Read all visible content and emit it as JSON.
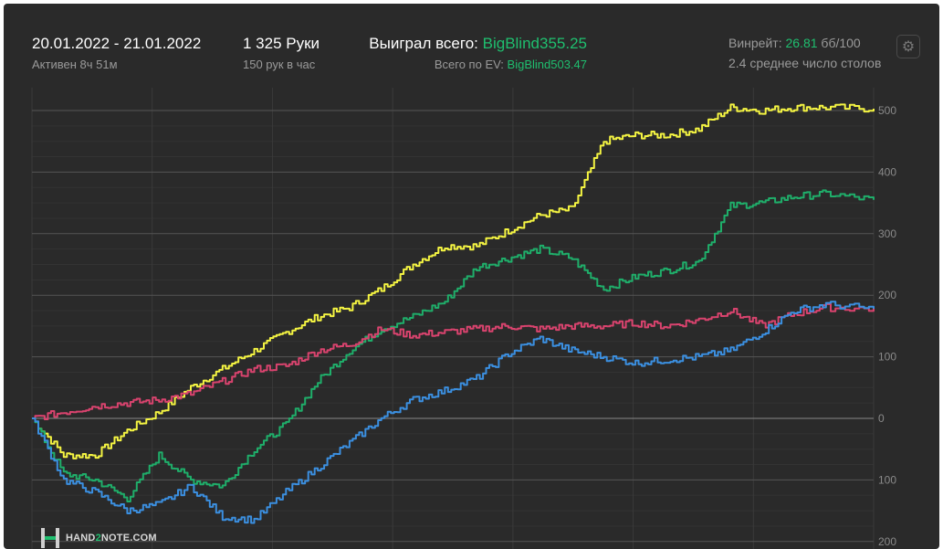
{
  "header": {
    "date_range": "20.01.2022 - 21.01.2022",
    "active_time": "Активен 8ч 51м",
    "hands": "1 325 Руки",
    "hands_per_hour": "150 рук в час",
    "won_label": "Выиграл всего: ",
    "won_value": "BigBlind355.25",
    "ev_label": "Всего по EV: ",
    "ev_value": "BigBlind503.47",
    "winrate_label": "Винрейт: ",
    "winrate_value": "26.81",
    "winrate_unit": " бб/100",
    "avg_tables": "2.4 среднее число столов"
  },
  "settings": {
    "icon": "gear-icon"
  },
  "logo": {
    "text_a": "HAND",
    "text_b": "2",
    "text_c": "NOTE.COM"
  },
  "colors": {
    "background": "#2a2a2a",
    "yellow": "#f4f442",
    "green": "#1fae6a",
    "pink": "#d9436e",
    "blue": "#3b8fe0",
    "accent": "#1fbf6f"
  },
  "chart_data": {
    "type": "line",
    "x": [
      0,
      50,
      100,
      150,
      200,
      250,
      300,
      350,
      400,
      450,
      500,
      550,
      600,
      650,
      700,
      750,
      800,
      850,
      900,
      950,
      1000,
      1050,
      1100,
      1150,
      1200,
      1250,
      1325
    ],
    "ylim": [
      -200,
      520
    ],
    "yticks": [
      500,
      400,
      300,
      200,
      100,
      0,
      -100,
      -200
    ],
    "ytick_labels": [
      "500",
      "400",
      "300",
      "200",
      "100",
      "0",
      "100",
      "200"
    ],
    "grid": true,
    "series": [
      {
        "color": "#f4f442",
        "values": [
          0,
          -60,
          -60,
          -20,
          10,
          50,
          80,
          110,
          140,
          165,
          180,
          210,
          250,
          280,
          280,
          305,
          330,
          340,
          450,
          460,
          460,
          470,
          505,
          500,
          505,
          505,
          503
        ]
      },
      {
        "color": "#1fae6a",
        "values": [
          0,
          -90,
          -100,
          -130,
          -60,
          -100,
          -110,
          -50,
          -10,
          60,
          110,
          145,
          165,
          190,
          245,
          260,
          275,
          260,
          210,
          230,
          240,
          255,
          345,
          350,
          360,
          365,
          355
        ]
      },
      {
        "color": "#d9436e",
        "values": [
          0,
          10,
          20,
          25,
          30,
          40,
          60,
          80,
          85,
          110,
          120,
          145,
          135,
          140,
          145,
          150,
          145,
          150,
          150,
          155,
          150,
          160,
          175,
          150,
          170,
          180,
          178
        ]
      },
      {
        "color": "#3b8fe0",
        "values": [
          0,
          -100,
          -120,
          -150,
          -140,
          -110,
          -160,
          -165,
          -120,
          -80,
          -40,
          0,
          30,
          45,
          65,
          105,
          130,
          110,
          100,
          90,
          95,
          100,
          110,
          140,
          175,
          185,
          178
        ]
      }
    ]
  }
}
